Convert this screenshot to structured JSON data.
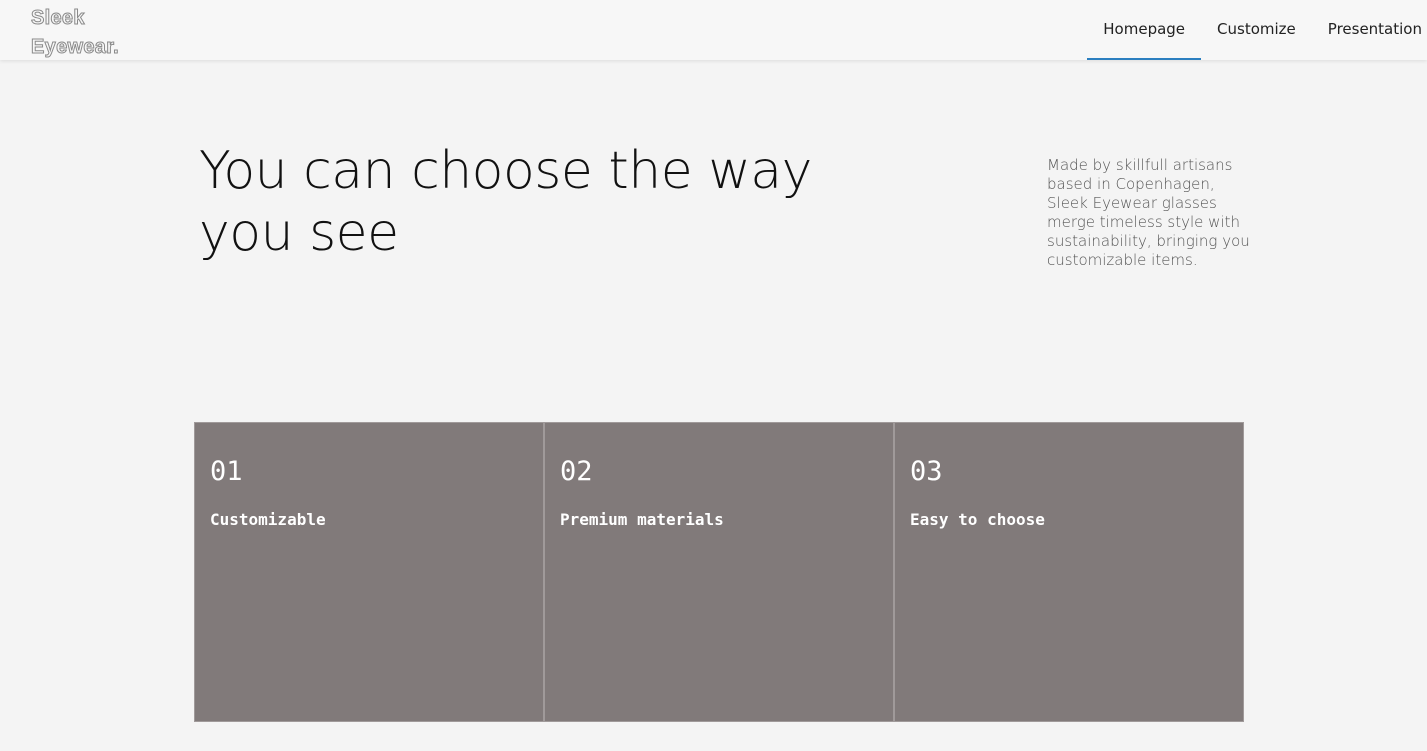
{
  "header": {
    "logo_line1": "Sleek",
    "logo_line2": "Eyewear.",
    "nav": [
      {
        "label": "Homepage"
      },
      {
        "label": "Customize"
      },
      {
        "label": "Presentation"
      }
    ]
  },
  "hero": {
    "title": "You can choose the way you see",
    "description": "Made by skillfull artisans based in Copenhagen, Sleek Eyewear glasses merge timeless style with sustainability, bringing you customizable items."
  },
  "features": [
    {
      "number": "01",
      "title": "Customizable"
    },
    {
      "number": "02",
      "title": "Premium materials"
    },
    {
      "number": "03",
      "title": "Easy to choose"
    }
  ],
  "colors": {
    "accent": "#2b7fc0",
    "card_bg": "#817a7a",
    "page_bg": "#f4f4f4"
  }
}
